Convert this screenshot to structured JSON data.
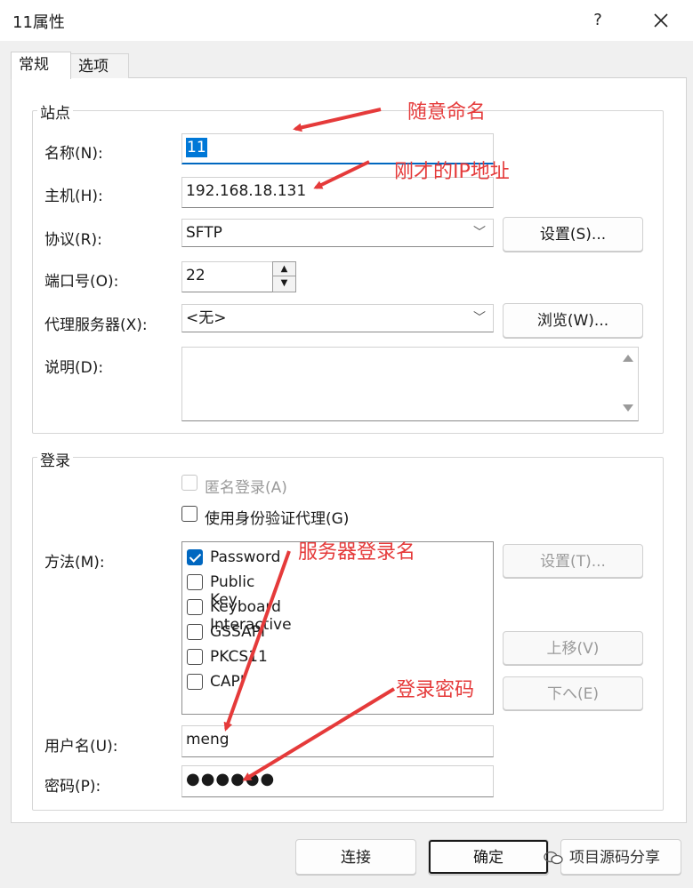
{
  "window": {
    "title": "11属性",
    "help_label": "?"
  },
  "tabs": [
    {
      "label": "常规"
    },
    {
      "label": "选项"
    }
  ],
  "site_group": {
    "label": "站点",
    "name_label": "名称(N):",
    "name_value": "11",
    "host_label": "主机(H):",
    "host_value": "192.168.18.131",
    "protocol_label": "协议(R):",
    "protocol_value": "SFTP",
    "protocol_settings_button": "设置(S)...",
    "port_label": "端口号(O):",
    "port_value": "22",
    "proxy_label": "代理服务器(X):",
    "proxy_value": "<无>",
    "browse_button": "浏览(W)...",
    "description_label": "说明(D):",
    "description_value": ""
  },
  "login_group": {
    "label": "登录",
    "anonymous_label": "匿名登录(A)",
    "agent_label": "使用身份验证代理(G)",
    "method_label": "方法(M):",
    "methods": [
      {
        "label": "Password",
        "checked": true
      },
      {
        "label": "Public Key",
        "checked": false
      },
      {
        "label": "Keyboard Interactive",
        "checked": false
      },
      {
        "label": "GSSAPI",
        "checked": false
      },
      {
        "label": "PKCS11",
        "checked": false
      },
      {
        "label": "CAPI",
        "checked": false
      }
    ],
    "method_settings_button": "设置(T)...",
    "move_up_button": "上移(V)",
    "move_down_button": "下へ(E)",
    "username_label": "用户名(U):",
    "username_value": "meng",
    "password_label": "密码(P):",
    "password_value": "●●●●●●"
  },
  "footer": {
    "connect_button": "连接",
    "ok_button": "确定"
  },
  "annotations": {
    "name_note": "随意命名",
    "host_note": "刚才的IP地址",
    "user_note": "服务器登录名",
    "password_note": "登录密码"
  },
  "watermark": {
    "text": "项目源码分享"
  },
  "colors": {
    "accent": "#0067c0",
    "annotation": "#e53a3a"
  }
}
